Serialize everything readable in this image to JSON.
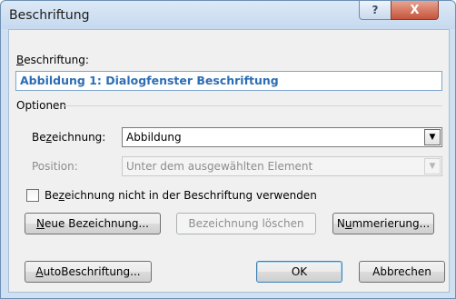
{
  "window": {
    "title": "Beschriftung",
    "help_glyph": "?",
    "close_glyph": "X"
  },
  "caption": {
    "label": "Beschriftung:",
    "label_mnemonic": "B",
    "label_rest": "eschriftung:",
    "value": "Abbildung 1: Dialogfenster Beschriftung"
  },
  "options": {
    "group_label": "Optionen",
    "label_select": {
      "label_pre": "Be",
      "label_mnemonic": "z",
      "label_post": "eichnung:",
      "value": "Abbildung"
    },
    "position_select": {
      "label": "Position:",
      "value": "Unter dem ausgewählten Element",
      "disabled": true
    }
  },
  "exclude_label": {
    "label_pre": "Be",
    "label_mnemonic": "z",
    "label_post": "eichnung nicht in der Beschriftung verwenden",
    "checked": false
  },
  "buttons": {
    "new_label": {
      "mnemonic": "N",
      "rest": "eue Bezeichnung..."
    },
    "delete_label": {
      "label": "Bezeichnung löschen",
      "disabled": true
    },
    "numbering": {
      "pre": "N",
      "mnemonic": "u",
      "post": "mmerierung..."
    },
    "autocaption": {
      "mnemonic": "A",
      "rest": "utoBeschriftung..."
    },
    "ok": {
      "label": "OK"
    },
    "cancel": {
      "label": "Abbrechen"
    }
  },
  "icons": {
    "dropdown_arrow": "▼"
  }
}
